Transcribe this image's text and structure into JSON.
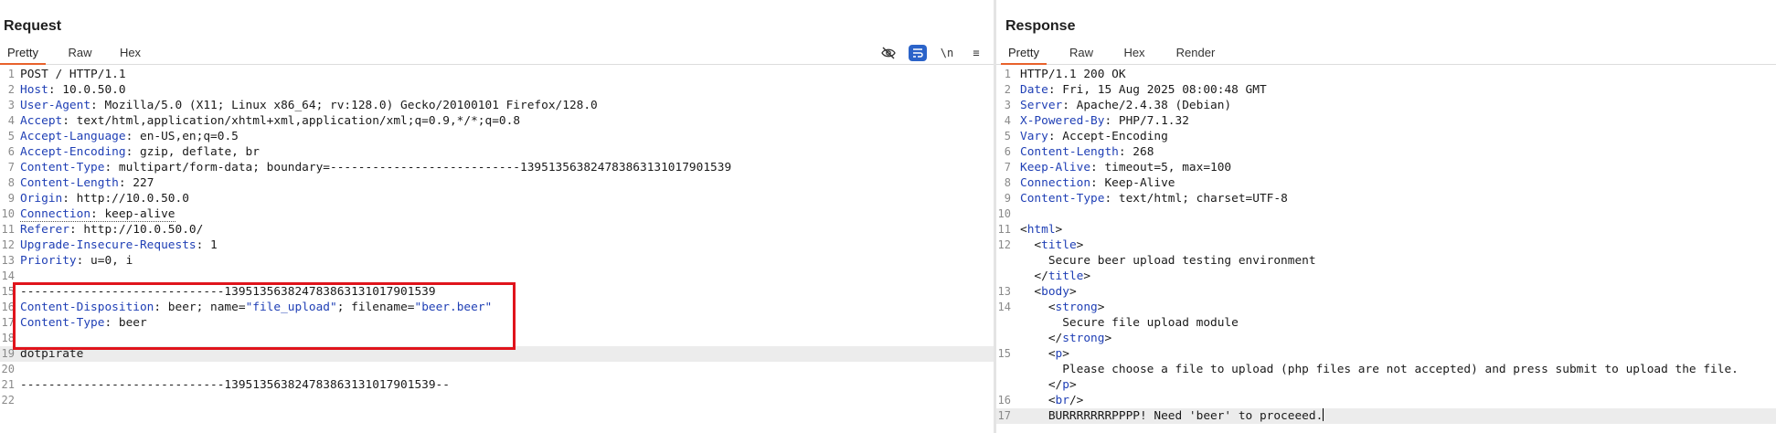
{
  "request": {
    "title": "Request",
    "tabs": [
      "Pretty",
      "Raw",
      "Hex"
    ],
    "active_tab": "Pretty",
    "toolbar": {
      "newline_label": "\\n",
      "menu_label": "≡"
    },
    "lines": [
      {
        "n": "1",
        "parts": [
          {
            "t": "POST / HTTP/1.1"
          }
        ]
      },
      {
        "n": "2",
        "parts": [
          {
            "t": "Host",
            "c": "hk"
          },
          {
            "t": ": 10.0.50.0"
          }
        ]
      },
      {
        "n": "3",
        "parts": [
          {
            "t": "User-Agent",
            "c": "hk"
          },
          {
            "t": ": Mozilla/5.0 (X11; Linux x86_64; rv:128.0) Gecko/20100101 Firefox/128.0"
          }
        ]
      },
      {
        "n": "4",
        "parts": [
          {
            "t": "Accept",
            "c": "hk"
          },
          {
            "t": ": text/html,application/xhtml+xml,application/xml;q=0.9,*/*;q=0.8"
          }
        ]
      },
      {
        "n": "5",
        "parts": [
          {
            "t": "Accept-Language",
            "c": "hk"
          },
          {
            "t": ": en-US,en;q=0.5"
          }
        ]
      },
      {
        "n": "6",
        "parts": [
          {
            "t": "Accept-Encoding",
            "c": "hk"
          },
          {
            "t": ": gzip, deflate, br"
          }
        ]
      },
      {
        "n": "7",
        "parts": [
          {
            "t": "Content-Type",
            "c": "hk"
          },
          {
            "t": ": multipart/form-data; boundary=---------------------------139513563824783863131017901539"
          }
        ]
      },
      {
        "n": "8",
        "parts": [
          {
            "t": "Content-Length",
            "c": "hk"
          },
          {
            "t": ": 227"
          }
        ]
      },
      {
        "n": "9",
        "parts": [
          {
            "t": "Origin",
            "c": "hk"
          },
          {
            "t": ": http://10.0.50.0"
          }
        ]
      },
      {
        "n": "10",
        "parts": [
          {
            "t": "Connection",
            "c": "hk dotted"
          },
          {
            "t": ": keep-alive",
            "c": "dotted"
          }
        ]
      },
      {
        "n": "11",
        "parts": [
          {
            "t": "Referer",
            "c": "hk"
          },
          {
            "t": ": http://10.0.50.0/"
          }
        ]
      },
      {
        "n": "12",
        "parts": [
          {
            "t": "Upgrade-Insecure-Requests",
            "c": "hk"
          },
          {
            "t": ": 1"
          }
        ]
      },
      {
        "n": "13",
        "parts": [
          {
            "t": "Priority",
            "c": "hk"
          },
          {
            "t": ": u=0, i"
          }
        ]
      },
      {
        "n": "14",
        "parts": []
      },
      {
        "n": "15",
        "parts": [
          {
            "t": "-----------------------------139513563824783863131017901539"
          }
        ]
      },
      {
        "n": "16",
        "parts": [
          {
            "t": "Content-Disposition",
            "c": "hk"
          },
          {
            "t": ": beer; name="
          },
          {
            "t": "\"file_upload\"",
            "c": "str"
          },
          {
            "t": "; filename="
          },
          {
            "t": "\"beer.beer\"",
            "c": "str"
          }
        ]
      },
      {
        "n": "17",
        "parts": [
          {
            "t": "Content-Type",
            "c": "hk"
          },
          {
            "t": ": beer"
          }
        ]
      },
      {
        "n": "18",
        "parts": []
      },
      {
        "n": "19",
        "cur": true,
        "parts": [
          {
            "t": "dotpirate"
          }
        ]
      },
      {
        "n": "20",
        "parts": []
      },
      {
        "n": "21",
        "parts": [
          {
            "t": "-----------------------------139513563824783863131017901539--"
          }
        ]
      },
      {
        "n": "22",
        "parts": []
      }
    ]
  },
  "response": {
    "title": "Response",
    "tabs": [
      "Pretty",
      "Raw",
      "Hex",
      "Render"
    ],
    "active_tab": "Pretty",
    "lines": [
      {
        "n": "1",
        "parts": [
          {
            "t": "HTTP/1.1 200 OK"
          }
        ]
      },
      {
        "n": "2",
        "parts": [
          {
            "t": "Date",
            "c": "hk"
          },
          {
            "t": ": Fri, 15 Aug 2025 08:00:48 GMT"
          }
        ]
      },
      {
        "n": "3",
        "parts": [
          {
            "t": "Server",
            "c": "hk"
          },
          {
            "t": ": Apache/2.4.38 (Debian)"
          }
        ]
      },
      {
        "n": "4",
        "parts": [
          {
            "t": "X-Powered-By",
            "c": "hk"
          },
          {
            "t": ": PHP/7.1.32"
          }
        ]
      },
      {
        "n": "5",
        "parts": [
          {
            "t": "Vary",
            "c": "hk"
          },
          {
            "t": ": Accept-Encoding"
          }
        ]
      },
      {
        "n": "6",
        "parts": [
          {
            "t": "Content-Length",
            "c": "hk"
          },
          {
            "t": ": 268"
          }
        ]
      },
      {
        "n": "7",
        "parts": [
          {
            "t": "Keep-Alive",
            "c": "hk"
          },
          {
            "t": ": timeout=5, max=100"
          }
        ]
      },
      {
        "n": "8",
        "parts": [
          {
            "t": "Connection",
            "c": "hk"
          },
          {
            "t": ": Keep-Alive"
          }
        ]
      },
      {
        "n": "9",
        "parts": [
          {
            "t": "Content-Type",
            "c": "hk"
          },
          {
            "t": ": text/html; charset=UTF-8"
          }
        ]
      },
      {
        "n": "10",
        "parts": []
      },
      {
        "n": "11",
        "parts": [
          {
            "t": "<"
          },
          {
            "t": "html",
            "c": "tag"
          },
          {
            "t": ">"
          }
        ]
      },
      {
        "n": "12",
        "parts": [
          {
            "t": "  <"
          },
          {
            "t": "title",
            "c": "tag"
          },
          {
            "t": ">"
          }
        ]
      },
      {
        "n": "",
        "parts": [
          {
            "t": "    Secure beer upload testing environment"
          }
        ]
      },
      {
        "n": "",
        "parts": [
          {
            "t": "  </"
          },
          {
            "t": "title",
            "c": "tag"
          },
          {
            "t": ">"
          }
        ]
      },
      {
        "n": "13",
        "parts": [
          {
            "t": "  <"
          },
          {
            "t": "body",
            "c": "tag"
          },
          {
            "t": ">"
          }
        ]
      },
      {
        "n": "14",
        "parts": [
          {
            "t": "    <"
          },
          {
            "t": "strong",
            "c": "tag"
          },
          {
            "t": ">"
          }
        ]
      },
      {
        "n": "",
        "parts": [
          {
            "t": "      Secure file upload module"
          }
        ]
      },
      {
        "n": "",
        "parts": [
          {
            "t": "    </"
          },
          {
            "t": "strong",
            "c": "tag"
          },
          {
            "t": ">"
          }
        ]
      },
      {
        "n": "15",
        "parts": [
          {
            "t": "    <"
          },
          {
            "t": "p",
            "c": "tag"
          },
          {
            "t": ">"
          }
        ]
      },
      {
        "n": "",
        "parts": [
          {
            "t": "      Please choose a file to upload (php files are not accepted) and press submit to upload the file."
          }
        ]
      },
      {
        "n": "",
        "parts": [
          {
            "t": "    </"
          },
          {
            "t": "p",
            "c": "tag"
          },
          {
            "t": ">"
          }
        ]
      },
      {
        "n": "16",
        "parts": [
          {
            "t": "    <"
          },
          {
            "t": "br",
            "c": "tag"
          },
          {
            "t": "/>"
          }
        ]
      },
      {
        "n": "17",
        "cur": true,
        "caret": true,
        "parts": [
          {
            "t": "    BURRRRRRRPPPP! Need 'beer' to proceeed."
          }
        ]
      }
    ]
  }
}
